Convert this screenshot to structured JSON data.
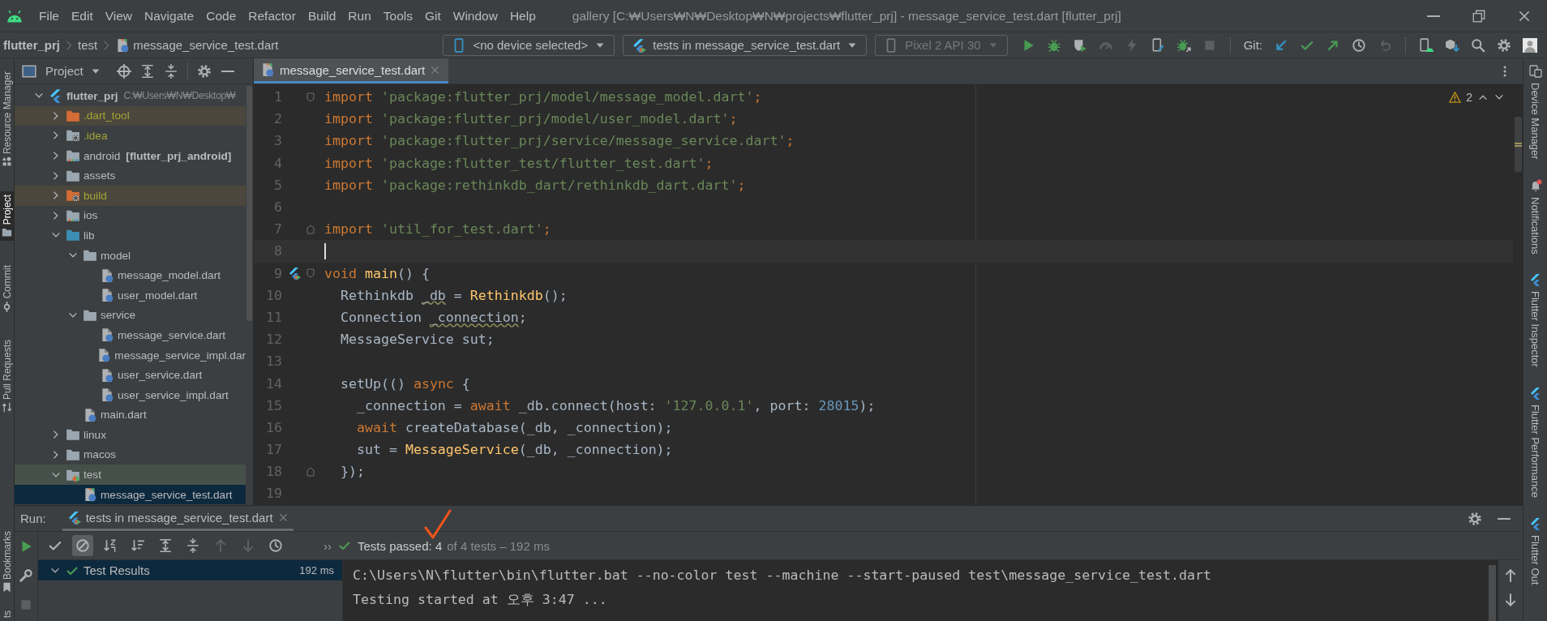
{
  "window": {
    "title": "gallery [C:₩Users₩N₩Desktop₩N₩projects₩flutter_prj] - message_service_test.dart [flutter_prj]"
  },
  "menu": [
    "File",
    "Edit",
    "View",
    "Navigate",
    "Code",
    "Refactor",
    "Build",
    "Run",
    "Tools",
    "Git",
    "Window",
    "Help"
  ],
  "breadcrumb": [
    {
      "label": "flutter_prj",
      "kind": "project"
    },
    {
      "label": "test",
      "kind": "folder"
    },
    {
      "label": "message_service_test.dart",
      "kind": "test-file"
    }
  ],
  "toolbar": {
    "device": "<no device selected>",
    "run_config": "tests in message_service_test.dart",
    "emulator": {
      "label": "Pixel 2 API 30",
      "disabled": true
    },
    "actions": [
      {
        "kind": "run",
        "disabled": false
      },
      {
        "kind": "debug",
        "disabled": false
      },
      {
        "kind": "coverage",
        "disabled": false
      },
      {
        "kind": "profile",
        "disabled": true
      },
      {
        "kind": "bolt",
        "disabled": true
      },
      {
        "kind": "device-edit",
        "disabled": false
      },
      {
        "kind": "attach",
        "disabled": false
      },
      {
        "kind": "stop",
        "disabled": true
      }
    ],
    "git_label": "Git:",
    "git_actions": [
      {
        "kind": "update",
        "disabled": false
      },
      {
        "kind": "commit",
        "disabled": false
      },
      {
        "kind": "push",
        "disabled": false
      },
      {
        "kind": "history",
        "disabled": false
      },
      {
        "kind": "rollback",
        "disabled": true
      }
    ],
    "extra_actions": [
      {
        "kind": "device-manager",
        "disabled": false
      },
      {
        "kind": "sdk",
        "disabled": false
      },
      {
        "kind": "search",
        "disabled": false
      },
      {
        "kind": "settings",
        "disabled": false
      },
      {
        "kind": "avatar"
      }
    ]
  },
  "left_stripe": {
    "top": [
      {
        "label": "Resource Manager",
        "kind": "resources",
        "selected": false
      },
      {
        "label": "Project",
        "kind": "folder",
        "selected": true
      },
      {
        "label": "Commit",
        "kind": "commit",
        "selected": false
      },
      {
        "label": "Pull Requests",
        "kind": "pull",
        "selected": false
      }
    ],
    "bottom": [
      {
        "label": "Bookmarks",
        "kind": "bookmark",
        "selected": false
      },
      {
        "label": "ts",
        "kind": "none",
        "selected": false
      }
    ]
  },
  "right_stripe": [
    {
      "label": "Device Manager",
      "kind": "devices",
      "unread": false
    },
    {
      "label": "Notifications",
      "kind": "bell",
      "unread": true
    },
    {
      "label": "Flutter Inspector",
      "kind": "flutter",
      "unread": false
    },
    {
      "label": "Flutter Performance",
      "kind": "flutter",
      "unread": false
    },
    {
      "label": "Flutter Out",
      "kind": "flutter",
      "unread": false
    }
  ],
  "project_panel": {
    "title": "Project",
    "tree": [
      {
        "label": "flutter_prj",
        "kind": "flutter",
        "path": "C:₩Users₩N₩Desktop₩",
        "expanded": true,
        "selected": false,
        "children": [
          {
            "label": ".dart_tool",
            "kind": "folder-orange",
            "ignored": true,
            "expanded": false,
            "selected": false
          },
          {
            "label": ".idea",
            "kind": "folder-gear",
            "ignored": true,
            "expanded": false,
            "selected": false
          },
          {
            "label": "android",
            "kind": "folder-module",
            "module": "[flutter_prj_android]",
            "ignored": false,
            "expanded": false,
            "selected": false
          },
          {
            "label": "assets",
            "kind": "folder",
            "ignored": false,
            "expanded": false,
            "selected": false
          },
          {
            "label": "build",
            "kind": "folder-orange-gear",
            "ignored": true,
            "expanded": false,
            "selected": false
          },
          {
            "label": "ios",
            "kind": "folder-module",
            "ignored": false,
            "expanded": false,
            "selected": false
          },
          {
            "label": "lib",
            "kind": "folder-blue",
            "ignored": false,
            "expanded": true,
            "selected": false,
            "children": [
              {
                "label": "model",
                "kind": "folder",
                "expanded": true,
                "selected": false,
                "children": [
                  {
                    "label": "message_model.dart",
                    "kind": "dart",
                    "selected": false
                  },
                  {
                    "label": "user_model.dart",
                    "kind": "dart",
                    "selected": false
                  }
                ]
              },
              {
                "label": "service",
                "kind": "folder",
                "expanded": true,
                "selected": false,
                "children": [
                  {
                    "label": "message_service.dart",
                    "kind": "dart",
                    "selected": false
                  },
                  {
                    "label": "message_service_impl.dar",
                    "kind": "dart",
                    "selected": false
                  },
                  {
                    "label": "user_service.dart",
                    "kind": "dart",
                    "selected": false
                  },
                  {
                    "label": "user_service_impl.dart",
                    "kind": "dart",
                    "selected": false
                  }
                ]
              },
              {
                "label": "main.dart",
                "kind": "dart",
                "selected": false
              }
            ]
          },
          {
            "label": "linux",
            "kind": "folder",
            "ignored": false,
            "expanded": false,
            "selected": false
          },
          {
            "label": "macos",
            "kind": "folder",
            "ignored": false,
            "expanded": false,
            "selected": false
          },
          {
            "label": "test",
            "kind": "folder-test",
            "ignored": false,
            "expanded": true,
            "selected": false,
            "children": [
              {
                "label": "message_service_test.dart",
                "kind": "test-file",
                "selected": true
              }
            ]
          }
        ]
      }
    ]
  },
  "editor": {
    "tabs": [
      {
        "label": "message_service_test.dart",
        "selected": true
      }
    ],
    "problems": "2",
    "lines": [
      {
        "number": "1",
        "current": false,
        "gutter": [
          {
            "kind": "fold-start"
          }
        ],
        "tokens": [
          {
            "kind": "kw",
            "t": "import "
          },
          {
            "kind": "str",
            "t": "'package:flutter_prj/model/message_model.dart'"
          },
          {
            "kind": "kw",
            "t": ";"
          }
        ]
      },
      {
        "number": "2",
        "current": false,
        "tokens": [
          {
            "kind": "kw",
            "t": "import "
          },
          {
            "kind": "str",
            "t": "'package:flutter_prj/model/user_model.dart'"
          },
          {
            "kind": "kw",
            "t": ";"
          }
        ]
      },
      {
        "number": "3",
        "current": false,
        "tokens": [
          {
            "kind": "kw",
            "t": "import "
          },
          {
            "kind": "str",
            "t": "'package:flutter_prj/service/message_service.dart'"
          },
          {
            "kind": "kw",
            "t": ";"
          }
        ]
      },
      {
        "number": "4",
        "current": false,
        "tokens": [
          {
            "kind": "kw",
            "t": "import "
          },
          {
            "kind": "str",
            "t": "'package:flutter_test/flutter_test.dart'"
          },
          {
            "kind": "kw",
            "t": ";"
          }
        ]
      },
      {
        "number": "5",
        "current": false,
        "tokens": [
          {
            "kind": "kw",
            "t": "import "
          },
          {
            "kind": "str",
            "t": "'package:rethinkdb_dart/rethinkdb_dart.dart'"
          },
          {
            "kind": "kw",
            "t": ";"
          }
        ]
      },
      {
        "number": "6",
        "current": false
      },
      {
        "number": "7",
        "current": false,
        "gutter": [
          {
            "kind": "fold-end"
          }
        ],
        "tokens": [
          {
            "kind": "kw",
            "t": "import "
          },
          {
            "kind": "str",
            "t": "'util_for_test.dart'"
          },
          {
            "kind": "kw",
            "t": ";"
          }
        ]
      },
      {
        "number": "8",
        "current": true
      },
      {
        "number": "9",
        "current": false,
        "gutter": [
          {
            "kind": "run"
          },
          {
            "kind": "fold-start"
          }
        ],
        "tokens": [
          {
            "kind": "kw",
            "t": "void "
          },
          {
            "kind": "fn",
            "t": "main"
          },
          {
            "kind": "plain",
            "t": "() {"
          }
        ]
      },
      {
        "number": "10",
        "current": false,
        "tokens": [
          {
            "kind": "plain",
            "t": "  Rethinkdb "
          },
          {
            "kind": "warn",
            "t": "_db"
          },
          {
            "kind": "plain",
            "t": " = "
          },
          {
            "kind": "fn",
            "t": "Rethinkdb"
          },
          {
            "kind": "plain",
            "t": "();"
          }
        ]
      },
      {
        "number": "11",
        "current": false,
        "tokens": [
          {
            "kind": "plain",
            "t": "  Connection "
          },
          {
            "kind": "warn",
            "t": "_connection"
          },
          {
            "kind": "plain",
            "t": ";"
          }
        ]
      },
      {
        "number": "12",
        "current": false,
        "tokens": [
          {
            "kind": "plain",
            "t": "  MessageService sut;"
          }
        ]
      },
      {
        "number": "13",
        "current": false
      },
      {
        "number": "14",
        "current": false,
        "tokens": [
          {
            "kind": "plain",
            "t": "  setUp(() "
          },
          {
            "kind": "kw",
            "t": "async"
          },
          {
            "kind": "plain",
            "t": " {"
          }
        ]
      },
      {
        "number": "15",
        "current": false,
        "tokens": [
          {
            "kind": "plain",
            "t": "    _connection = "
          },
          {
            "kind": "kw",
            "t": "await"
          },
          {
            "kind": "plain",
            "t": " _db.connect(host: "
          },
          {
            "kind": "str",
            "t": "'127.0.0.1'"
          },
          {
            "kind": "plain",
            "t": ", port: "
          },
          {
            "kind": "num",
            "t": "28015"
          },
          {
            "kind": "plain",
            "t": ");"
          }
        ]
      },
      {
        "number": "16",
        "current": false,
        "tokens": [
          {
            "kind": "kw",
            "t": "    await"
          },
          {
            "kind": "plain",
            "t": " createDatabase(_db, _connection);"
          }
        ]
      },
      {
        "number": "17",
        "current": false,
        "tokens": [
          {
            "kind": "plain",
            "t": "    sut = "
          },
          {
            "kind": "fn",
            "t": "MessageService"
          },
          {
            "kind": "plain",
            "t": "(_db, _connection);"
          }
        ]
      },
      {
        "number": "18",
        "current": false,
        "gutter": [
          {
            "kind": "fold-end"
          }
        ],
        "tokens": [
          {
            "kind": "plain",
            "t": "  });"
          }
        ]
      },
      {
        "number": "19",
        "current": false
      }
    ]
  },
  "run_panel": {
    "label": "Run:",
    "tabs": [
      {
        "label": "tests in message_service_test.dart",
        "selected": true
      }
    ],
    "side_actions": [
      {
        "kind": "run",
        "disabled": false
      },
      {
        "kind": "wrench",
        "disabled": false
      },
      {
        "kind": "stop",
        "disabled": true
      }
    ],
    "tools": [
      {
        "kind": "check",
        "on": false,
        "disabled": false
      },
      {
        "kind": "ignored",
        "on": true,
        "disabled": false
      },
      {
        "kind": "sort-alpha",
        "on": false,
        "disabled": false
      },
      {
        "kind": "sort-duration",
        "on": false,
        "disabled": false
      },
      {
        "kind": "expand",
        "on": false,
        "disabled": false
      },
      {
        "kind": "collapse",
        "on": false,
        "disabled": false
      },
      {
        "kind": "up",
        "on": false,
        "disabled": true
      },
      {
        "kind": "down",
        "on": false,
        "disabled": true
      },
      {
        "kind": "history",
        "on": false,
        "disabled": false
      }
    ],
    "more": "››",
    "status": "Tests passed: 4",
    "status_detail": "of 4 tests – 192 ms",
    "results": [
      {
        "label": "Test Results",
        "time": "192 ms",
        "expanded": true,
        "selected": true
      }
    ],
    "console": [
      "C:\\Users\\N\\flutter\\bin\\flutter.bat --no-color test --machine --start-paused test\\message_service_test.dart",
      "Testing started at 오후 3:47 ..."
    ]
  }
}
